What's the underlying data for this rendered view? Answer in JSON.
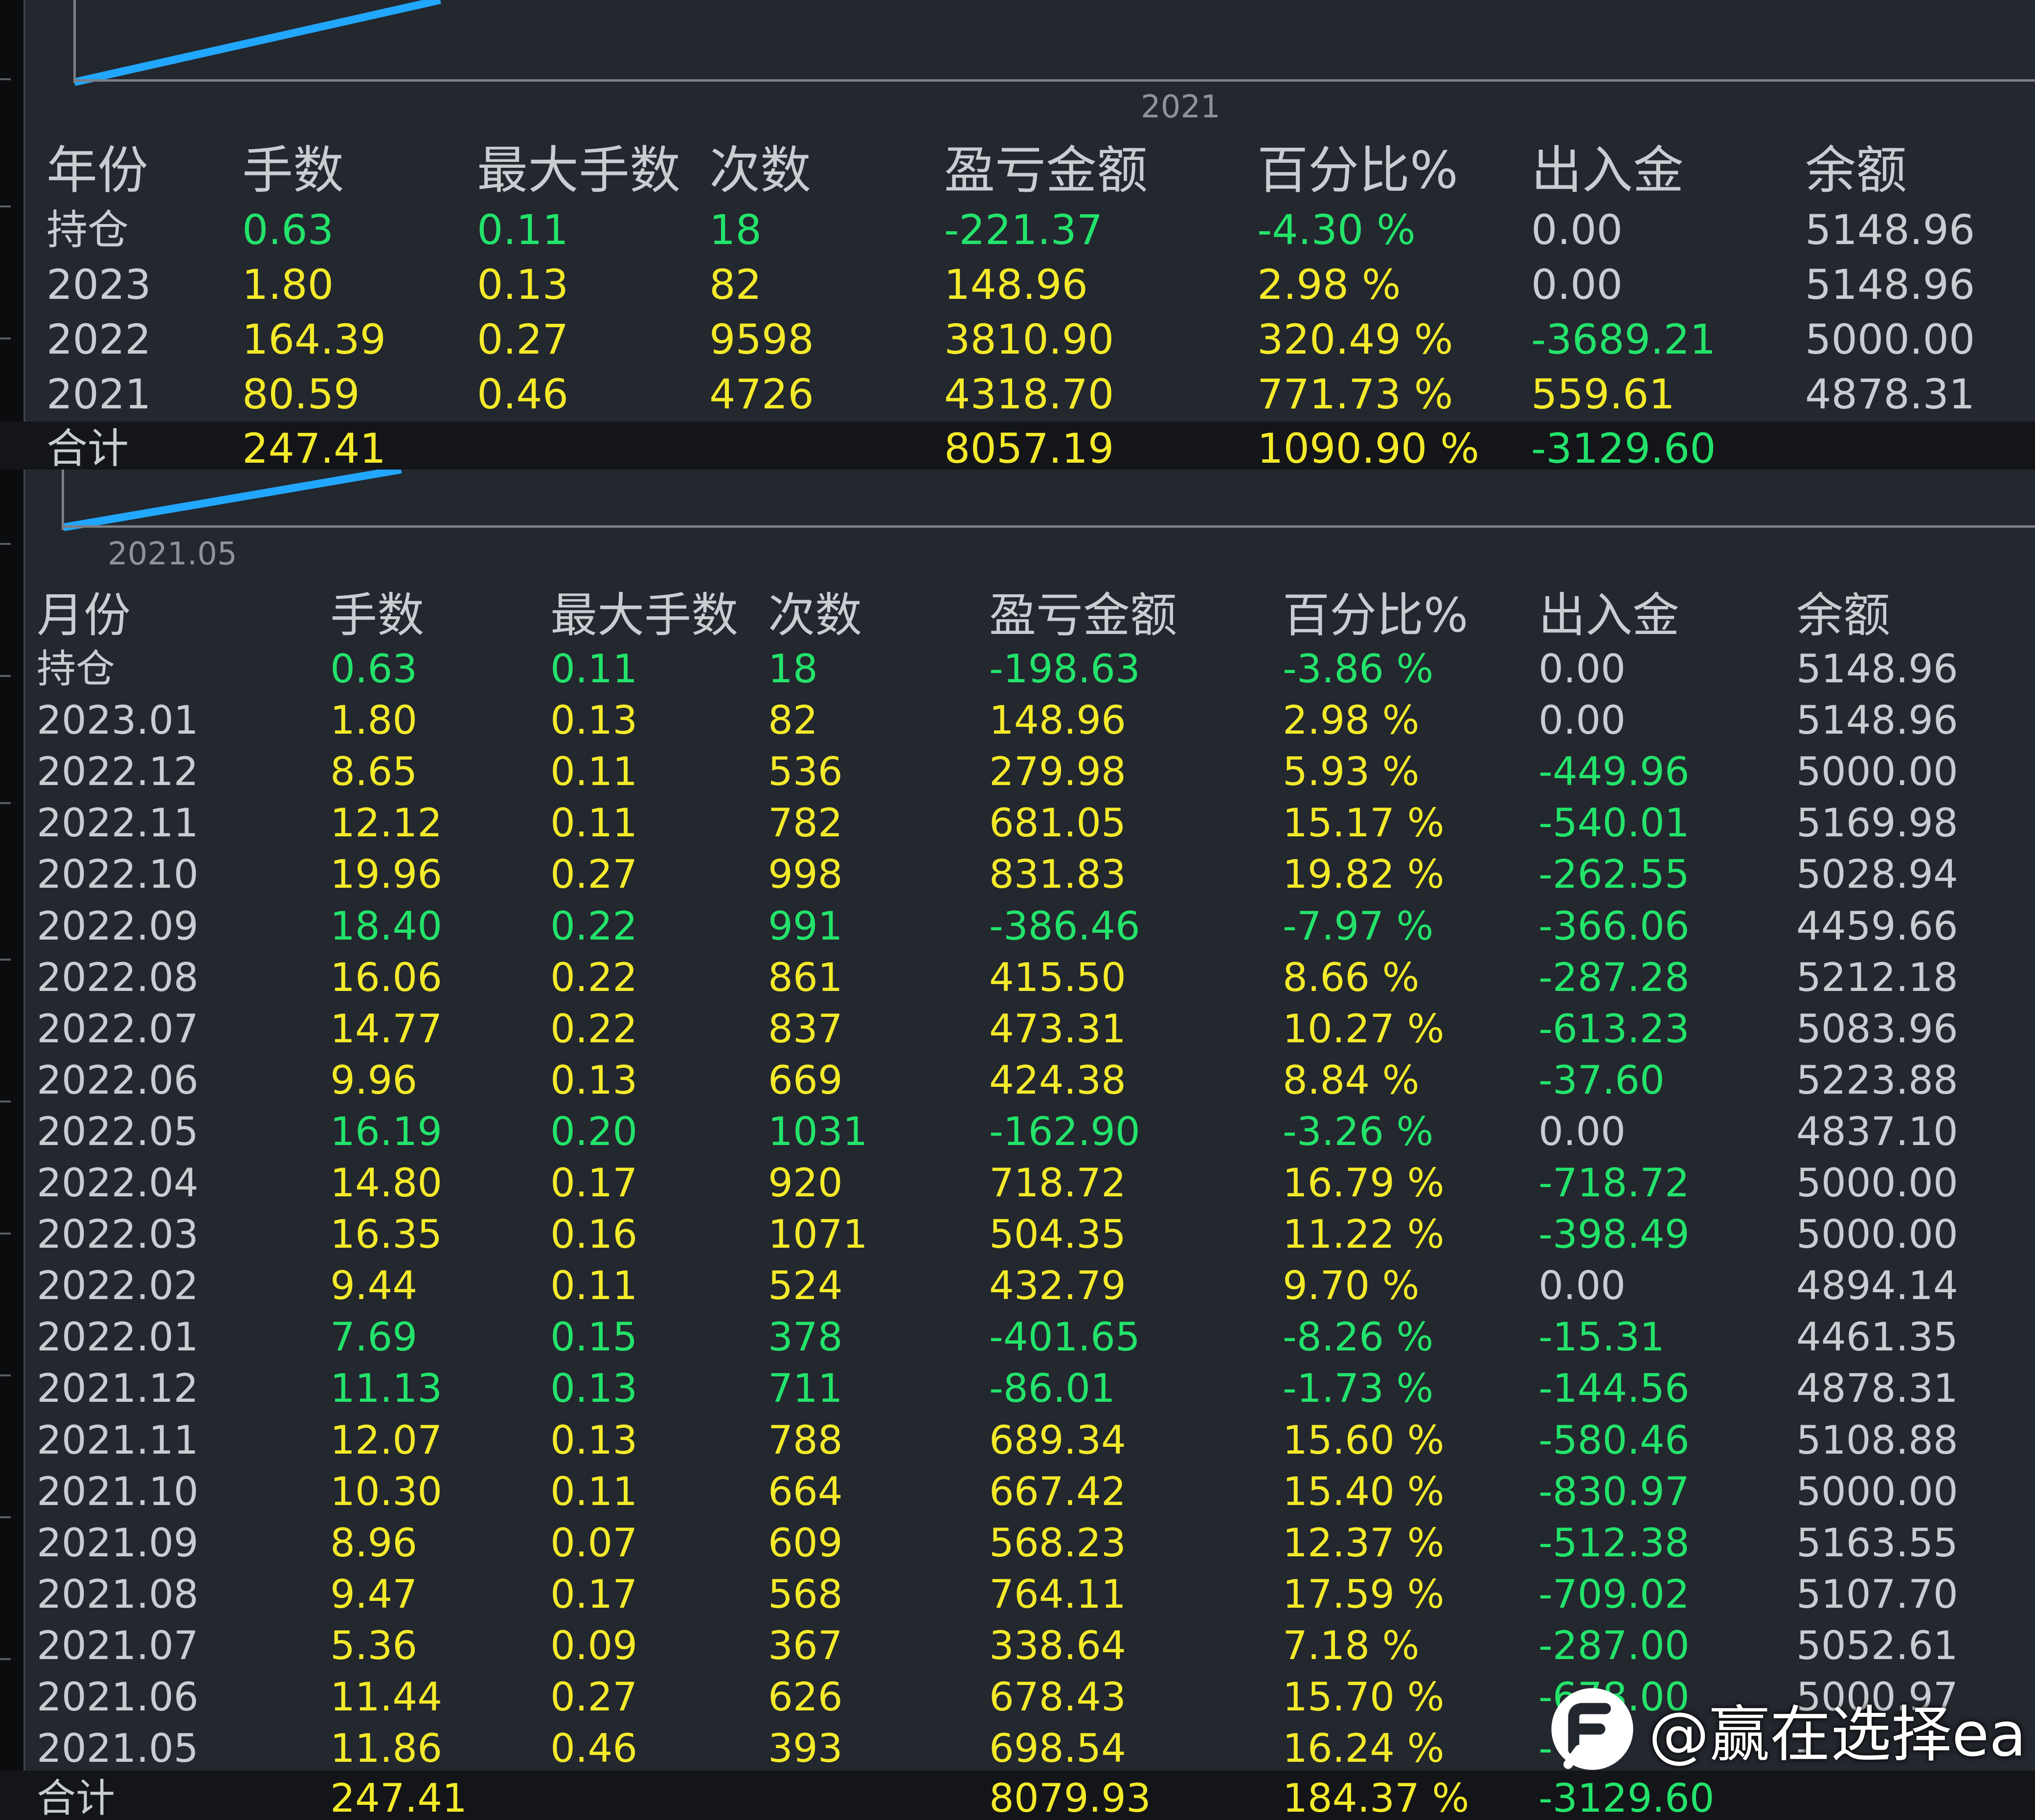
{
  "colors": {
    "yellow": "#f4ea2a",
    "green": "#23e36b",
    "white": "#c9ccd0",
    "line": "#21a7ff"
  },
  "yearly": {
    "axis_label": "2021",
    "headers": [
      "年份",
      "手数",
      "最大手数",
      "次数",
      "盈亏金额",
      "百分比%",
      "出入金",
      "余额"
    ],
    "rows": [
      {
        "label": "持仓",
        "cells": [
          "0.63",
          "0.11",
          "18",
          "-221.37",
          "-4.30 %",
          "0.00",
          "5148.96"
        ],
        "tone": [
          "grn",
          "grn",
          "grn",
          "grn",
          "grn",
          "wht",
          "wht"
        ]
      },
      {
        "label": "2023",
        "cells": [
          "1.80",
          "0.13",
          "82",
          "148.96",
          "2.98 %",
          "0.00",
          "5148.96"
        ],
        "tone": [
          "yel",
          "yel",
          "yel",
          "yel",
          "yel",
          "wht",
          "wht"
        ]
      },
      {
        "label": "2022",
        "cells": [
          "164.39",
          "0.27",
          "9598",
          "3810.90",
          "320.49 %",
          "-3689.21",
          "5000.00"
        ],
        "tone": [
          "yel",
          "yel",
          "yel",
          "yel",
          "yel",
          "grn",
          "wht"
        ]
      },
      {
        "label": "2021",
        "cells": [
          "80.59",
          "0.46",
          "4726",
          "4318.70",
          "771.73 %",
          "559.61",
          "4878.31"
        ],
        "tone": [
          "yel",
          "yel",
          "yel",
          "yel",
          "yel",
          "yel",
          "wht"
        ]
      }
    ],
    "total": {
      "label": "合计",
      "cells": [
        "247.41",
        "",
        "",
        "8057.19",
        "1090.90 %",
        "-3129.60",
        ""
      ],
      "tone": [
        "yel",
        "yel",
        "yel",
        "yel",
        "yel",
        "grn",
        "wht"
      ]
    }
  },
  "monthly": {
    "axis_label": "2021.05",
    "headers": [
      "月份",
      "手数",
      "最大手数",
      "次数",
      "盈亏金额",
      "百分比%",
      "出入金",
      "余额"
    ],
    "rows": [
      {
        "label": "持仓",
        "cells": [
          "0.63",
          "0.11",
          "18",
          "-198.63",
          "-3.86 %",
          "0.00",
          "5148.96"
        ],
        "tone": [
          "grn",
          "grn",
          "grn",
          "grn",
          "grn",
          "wht",
          "wht"
        ]
      },
      {
        "label": "2023.01",
        "cells": [
          "1.80",
          "0.13",
          "82",
          "148.96",
          "2.98 %",
          "0.00",
          "5148.96"
        ],
        "tone": [
          "yel",
          "yel",
          "yel",
          "yel",
          "yel",
          "wht",
          "wht"
        ]
      },
      {
        "label": "2022.12",
        "cells": [
          "8.65",
          "0.11",
          "536",
          "279.98",
          "5.93 %",
          "-449.96",
          "5000.00"
        ],
        "tone": [
          "yel",
          "yel",
          "yel",
          "yel",
          "yel",
          "grn",
          "wht"
        ]
      },
      {
        "label": "2022.11",
        "cells": [
          "12.12",
          "0.11",
          "782",
          "681.05",
          "15.17 %",
          "-540.01",
          "5169.98"
        ],
        "tone": [
          "yel",
          "yel",
          "yel",
          "yel",
          "yel",
          "grn",
          "wht"
        ]
      },
      {
        "label": "2022.10",
        "cells": [
          "19.96",
          "0.27",
          "998",
          "831.83",
          "19.82 %",
          "-262.55",
          "5028.94"
        ],
        "tone": [
          "yel",
          "yel",
          "yel",
          "yel",
          "yel",
          "grn",
          "wht"
        ]
      },
      {
        "label": "2022.09",
        "cells": [
          "18.40",
          "0.22",
          "991",
          "-386.46",
          "-7.97 %",
          "-366.06",
          "4459.66"
        ],
        "tone": [
          "grn",
          "grn",
          "grn",
          "grn",
          "grn",
          "grn",
          "wht"
        ]
      },
      {
        "label": "2022.08",
        "cells": [
          "16.06",
          "0.22",
          "861",
          "415.50",
          "8.66 %",
          "-287.28",
          "5212.18"
        ],
        "tone": [
          "yel",
          "yel",
          "yel",
          "yel",
          "yel",
          "grn",
          "wht"
        ]
      },
      {
        "label": "2022.07",
        "cells": [
          "14.77",
          "0.22",
          "837",
          "473.31",
          "10.27 %",
          "-613.23",
          "5083.96"
        ],
        "tone": [
          "yel",
          "yel",
          "yel",
          "yel",
          "yel",
          "grn",
          "wht"
        ]
      },
      {
        "label": "2022.06",
        "cells": [
          "9.96",
          "0.13",
          "669",
          "424.38",
          "8.84 %",
          "-37.60",
          "5223.88"
        ],
        "tone": [
          "yel",
          "yel",
          "yel",
          "yel",
          "yel",
          "grn",
          "wht"
        ]
      },
      {
        "label": "2022.05",
        "cells": [
          "16.19",
          "0.20",
          "1031",
          "-162.90",
          "-3.26 %",
          "0.00",
          "4837.10"
        ],
        "tone": [
          "grn",
          "grn",
          "grn",
          "grn",
          "grn",
          "wht",
          "wht"
        ]
      },
      {
        "label": "2022.04",
        "cells": [
          "14.80",
          "0.17",
          "920",
          "718.72",
          "16.79 %",
          "-718.72",
          "5000.00"
        ],
        "tone": [
          "yel",
          "yel",
          "yel",
          "yel",
          "yel",
          "grn",
          "wht"
        ]
      },
      {
        "label": "2022.03",
        "cells": [
          "16.35",
          "0.16",
          "1071",
          "504.35",
          "11.22 %",
          "-398.49",
          "5000.00"
        ],
        "tone": [
          "yel",
          "yel",
          "yel",
          "yel",
          "yel",
          "grn",
          "wht"
        ]
      },
      {
        "label": "2022.02",
        "cells": [
          "9.44",
          "0.11",
          "524",
          "432.79",
          "9.70 %",
          "0.00",
          "4894.14"
        ],
        "tone": [
          "yel",
          "yel",
          "yel",
          "yel",
          "yel",
          "wht",
          "wht"
        ]
      },
      {
        "label": "2022.01",
        "cells": [
          "7.69",
          "0.15",
          "378",
          "-401.65",
          "-8.26 %",
          "-15.31",
          "4461.35"
        ],
        "tone": [
          "grn",
          "grn",
          "grn",
          "grn",
          "grn",
          "grn",
          "wht"
        ]
      },
      {
        "label": "2021.12",
        "cells": [
          "11.13",
          "0.13",
          "711",
          "-86.01",
          "-1.73 %",
          "-144.56",
          "4878.31"
        ],
        "tone": [
          "grn",
          "grn",
          "grn",
          "grn",
          "grn",
          "grn",
          "wht"
        ]
      },
      {
        "label": "2021.11",
        "cells": [
          "12.07",
          "0.13",
          "788",
          "689.34",
          "15.60 %",
          "-580.46",
          "5108.88"
        ],
        "tone": [
          "yel",
          "yel",
          "yel",
          "yel",
          "yel",
          "grn",
          "wht"
        ]
      },
      {
        "label": "2021.10",
        "cells": [
          "10.30",
          "0.11",
          "664",
          "667.42",
          "15.40 %",
          "-830.97",
          "5000.00"
        ],
        "tone": [
          "yel",
          "yel",
          "yel",
          "yel",
          "yel",
          "grn",
          "wht"
        ]
      },
      {
        "label": "2021.09",
        "cells": [
          "8.96",
          "0.07",
          "609",
          "568.23",
          "12.37 %",
          "-512.38",
          "5163.55"
        ],
        "tone": [
          "yel",
          "yel",
          "yel",
          "yel",
          "yel",
          "grn",
          "wht"
        ]
      },
      {
        "label": "2021.08",
        "cells": [
          "9.47",
          "0.17",
          "568",
          "764.11",
          "17.59 %",
          "-709.02",
          "5107.70"
        ],
        "tone": [
          "yel",
          "yel",
          "yel",
          "yel",
          "yel",
          "grn",
          "wht"
        ]
      },
      {
        "label": "2021.07",
        "cells": [
          "5.36",
          "0.09",
          "367",
          "338.64",
          "7.18 %",
          "-287.00",
          "5052.61"
        ],
        "tone": [
          "yel",
          "yel",
          "yel",
          "yel",
          "yel",
          "grn",
          "wht"
        ]
      },
      {
        "label": "2021.06",
        "cells": [
          "11.44",
          "0.27",
          "626",
          "678.43",
          "15.70 %",
          "-678.00",
          "5000.97"
        ],
        "tone": [
          "yel",
          "yel",
          "yel",
          "yel",
          "yel",
          "grn",
          "wht"
        ]
      },
      {
        "label": "2021.05",
        "cells": [
          "11.86",
          "0.46",
          "393",
          "698.54",
          "16.24 %",
          "-",
          "-"
        ],
        "tone": [
          "yel",
          "yel",
          "yel",
          "yel",
          "yel",
          "grn",
          "wht"
        ]
      }
    ],
    "total": {
      "label": "合计",
      "cells": [
        "247.41",
        "",
        "",
        "8079.93",
        "184.37 %",
        "-3129.60",
        ""
      ],
      "tone": [
        "yel",
        "yel",
        "yel",
        "yel",
        "yel",
        "grn",
        "wht"
      ]
    }
  },
  "watermark": {
    "text": "@赢在选择ea",
    "logo_icon": "zhihu-logo-icon"
  }
}
